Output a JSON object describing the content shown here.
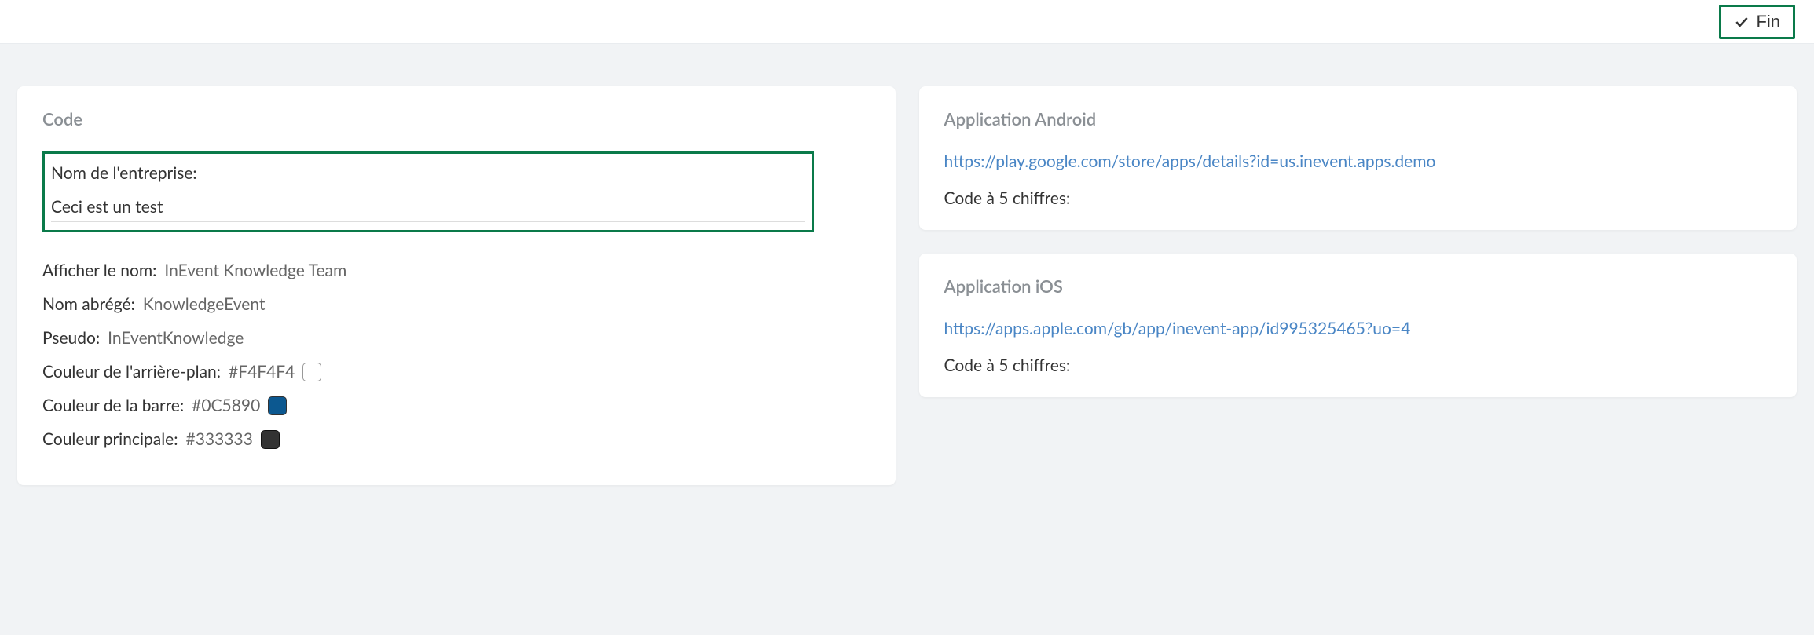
{
  "topbar": {
    "fin_label": "Fin"
  },
  "left_card": {
    "title": "Code",
    "company_name_label": "Nom de l'entreprise:",
    "company_name_value": "Ceci est un test",
    "display_name_label": "Afficher le nom:",
    "display_name_value": "InEvent Knowledge Team",
    "short_name_label": "Nom abrégé:",
    "short_name_value": "KnowledgeEvent",
    "pseudo_label": "Pseudo:",
    "pseudo_value": "InEventKnowledge",
    "bg_color_label": "Couleur de l'arrière-plan:",
    "bg_color_value": "#F4F4F4",
    "bar_color_label": "Couleur de la barre:",
    "bar_color_value": "#0C5890",
    "main_color_label": "Couleur principale:",
    "main_color_value": "#333333"
  },
  "android_card": {
    "title": "Application Android",
    "link_text": "https://play.google.com/store/apps/details?id=us.inevent.apps.demo",
    "code_label": "Code à 5 chiffres:"
  },
  "ios_card": {
    "title": "Application iOS",
    "link_text": "https://apps.apple.com/gb/app/inevent-app/id995325465?uo=4",
    "code_label": "Code à 5 chiffres:"
  }
}
